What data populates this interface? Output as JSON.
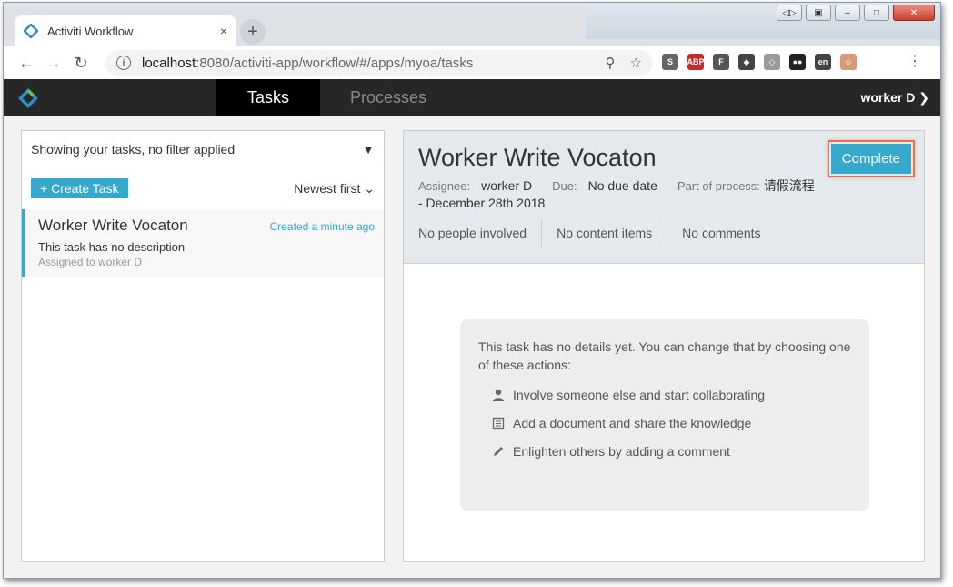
{
  "browser": {
    "tab_title": "Activiti Workflow",
    "tab_close": "×",
    "new_tab": "+",
    "url_host": "localhost",
    "url_path": ":8080/activiti-app/workflow/#/apps/myoa/tasks",
    "extensions": [
      {
        "name": "S",
        "color": "#666666"
      },
      {
        "name": "ABP",
        "color": "#c22c2c"
      },
      {
        "name": "F",
        "color": "#555555"
      },
      {
        "name": "◆",
        "color": "#444444"
      },
      {
        "name": "◇",
        "color": "#9a9a9a"
      },
      {
        "name": "●●",
        "color": "#222222"
      },
      {
        "name": "en",
        "color": "#444444"
      },
      {
        "name": "☺",
        "color": "#d89a7a"
      }
    ]
  },
  "app": {
    "tabs": [
      {
        "label": "Tasks",
        "active": true
      },
      {
        "label": "Processes",
        "active": false
      }
    ],
    "user": "worker D"
  },
  "task_list": {
    "filter_text": "Showing your tasks, no filter applied",
    "create_label": "+ Create Task",
    "sort_label": "Newest first",
    "items": [
      {
        "title": "Worker Write Vocaton",
        "created": "Created a minute ago",
        "description": "This task has no description",
        "assigned": "Assigned to worker D"
      }
    ]
  },
  "task_detail": {
    "title": "Worker Write Vocaton",
    "complete_label": "Complete",
    "assignee_label": "Assignee:",
    "assignee": "worker D",
    "due_label": "Due:",
    "due": "No due date",
    "process_label": "Part of process:",
    "process_value": "请假流程 - December 28th 2018",
    "tabs": [
      "No people involved",
      "No content items",
      "No comments"
    ],
    "empty": {
      "intro": "This task has no details yet. You can change that by choosing one of these actions:",
      "actions": [
        {
          "icon": "user-icon",
          "label": "Involve someone else and start collaborating"
        },
        {
          "icon": "document-icon",
          "label": "Add a document and share the knowledge"
        },
        {
          "icon": "pencil-icon",
          "label": "Enlighten others by adding a comment"
        }
      ]
    }
  },
  "colors": {
    "accent": "#35a8cc",
    "header_bg": "#272727",
    "highlight": "#e2734f"
  }
}
